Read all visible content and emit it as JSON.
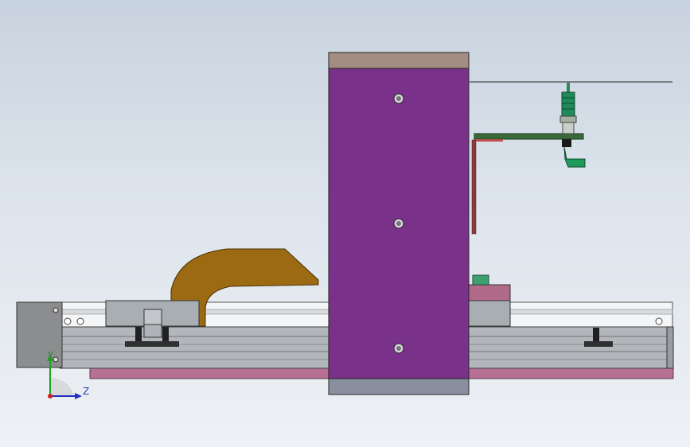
{
  "triad": {
    "y_label": "Y",
    "z_label": "Z"
  },
  "colors": {
    "background_top": "#c8d3df",
    "background_bottom": "#eef1f5",
    "main_block": "#7a318a",
    "main_block_cap": "#a38c84",
    "main_block_base": "#8a8fa0",
    "bracket": "#9b6a12",
    "base_plate": "#b86f94",
    "rail": "#b8bcc0",
    "carriage": "#a8adb2",
    "end_cap": "#8a8c8e",
    "sensor": "#2a8a5a",
    "pcb_bar": "#3a6a3a"
  },
  "icons": [
    "axis-triad-icon",
    "screw-hole-icon",
    "pneumatic-fitting-icon"
  ]
}
